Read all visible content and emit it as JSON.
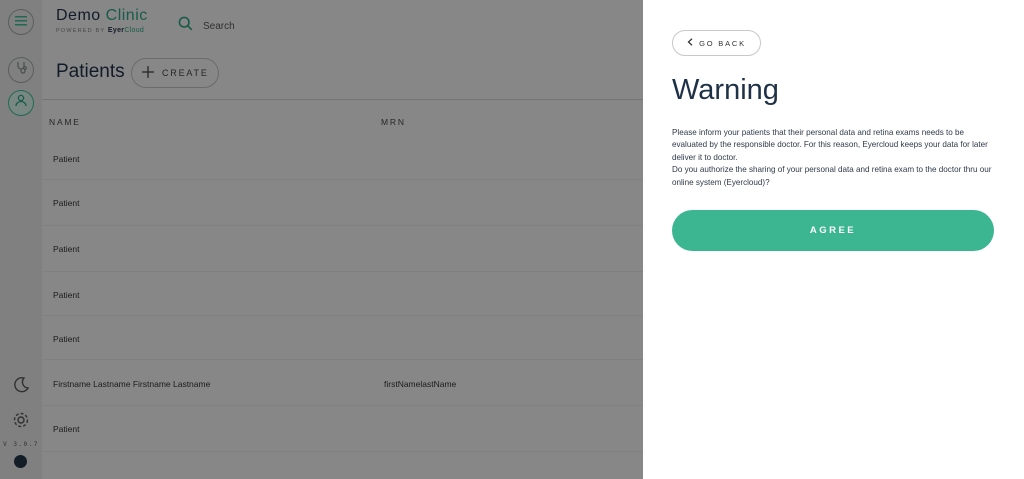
{
  "app": {
    "brand_name_1": "Demo",
    "brand_name_2": "Clinic",
    "powered_by": "POWERED BY",
    "powered_brand_1": "Eyer",
    "powered_brand_2": "Cloud",
    "search_label": "Search",
    "version": "V 3.0.7",
    "accent_color": "#3cb591",
    "navy_color": "#1f3147"
  },
  "sidebar": {
    "icons": [
      "menu-icon",
      "stethoscope-icon",
      "user-icon",
      "moon-icon",
      "gear-icon",
      "eyercloud-logo-icon"
    ]
  },
  "page": {
    "title": "Patients",
    "create_label": "CREATE"
  },
  "table": {
    "columns": [
      "NAME",
      "MRN"
    ],
    "rows": [
      {
        "name": "Patient",
        "mrn": ""
      },
      {
        "name": "Patient",
        "mrn": ""
      },
      {
        "name": "Patient",
        "mrn": ""
      },
      {
        "name": "Patient",
        "mrn": ""
      },
      {
        "name": "Patient",
        "mrn": ""
      },
      {
        "name": "Firstname Lastname Firstname Lastname",
        "mrn": "firstNamelastName"
      },
      {
        "name": "Patient",
        "mrn": ""
      }
    ]
  },
  "panel": {
    "back_label": "GO BACK",
    "title": "Warning",
    "paragraph_1": "Please inform your patients that their personal data and retina exams needs to be evaluated by the responsible doctor. For this reason, Eyercloud keeps your data for later deliver it to doctor.",
    "paragraph_2": "Do you authorize the sharing of your personal data and retina exam to the doctor thru our online system (Eyercloud)?",
    "agree_label": "AGREE"
  }
}
